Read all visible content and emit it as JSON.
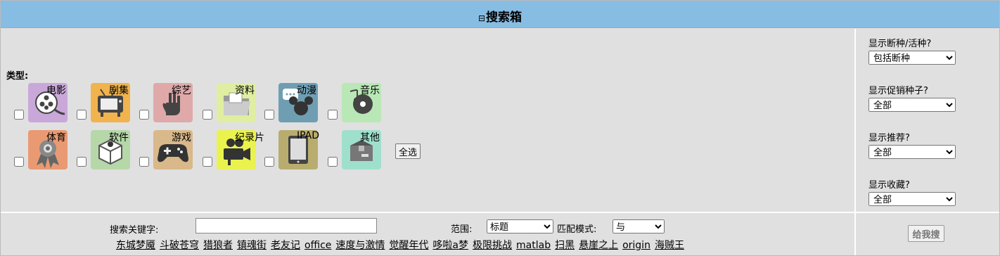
{
  "header": {
    "toggle_glyph": "⊟",
    "title": "搜索箱"
  },
  "types": {
    "label": "类型:",
    "categories": [
      {
        "label": "电影",
        "icon": "film-reel-icon",
        "color": "#c9a8d9"
      },
      {
        "label": "剧集",
        "icon": "tv-icon",
        "color": "#f0b34e"
      },
      {
        "label": "综艺",
        "icon": "hand-gesture-icon",
        "color": "#dfa9a9"
      },
      {
        "label": "资料",
        "icon": "folder-icon",
        "color": "#dfeea0"
      },
      {
        "label": "动漫",
        "icon": "mickey-icon",
        "color": "#6f9eb3"
      },
      {
        "label": "音乐",
        "icon": "music-disc-icon",
        "color": "#b9e8b6"
      },
      {
        "label": "体育",
        "icon": "medal-icon",
        "color": "#e99a73"
      },
      {
        "label": "软件",
        "icon": "software-box-icon",
        "color": "#b6d7a8"
      },
      {
        "label": "游戏",
        "icon": "gamepad-icon",
        "color": "#d9b88a"
      },
      {
        "label": "纪录片",
        "icon": "movie-camera-icon",
        "color": "#eaf24e"
      },
      {
        "label": "IPAD",
        "icon": "tablet-icon",
        "color": "#b8ad6f"
      },
      {
        "label": "其他",
        "icon": "package-icon",
        "color": "#9fe0cc"
      }
    ],
    "select_all_label": "全选"
  },
  "right_panel": {
    "dead_label": "显示断种/活种?",
    "dead_value": "包括断种",
    "promo_label": "显示促销种子?",
    "promo_value": "全部",
    "recommend_label": "显示推荐?",
    "recommend_value": "全部",
    "favorite_label": "显示收藏?",
    "favorite_value": "全部"
  },
  "search": {
    "keyword_label": "搜索关键字:",
    "keyword_value": "",
    "scope_label": "范围:",
    "scope_value": "标题",
    "mode_label": "匹配模式:",
    "mode_value": "与",
    "submit_label": "给我搜",
    "hot_keywords": [
      "东城梦魇",
      "斗破苍穹",
      "猎狼者",
      "镇魂街",
      "老友记",
      "office",
      "速度与激情",
      "觉醒年代",
      "哆啦a梦",
      "极限挑战",
      "matlab",
      "扫黑",
      "悬崖之上",
      "origin",
      "海贼王"
    ]
  }
}
